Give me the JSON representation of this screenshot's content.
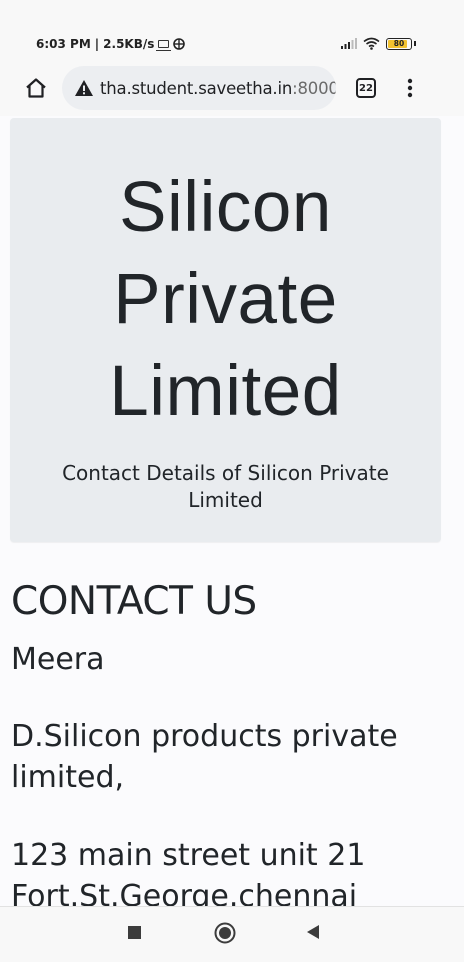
{
  "status_bar": {
    "time": "6:03 PM",
    "network_speed": "2.5KB/s",
    "battery_level": "80",
    "icons": [
      "laptop-icon",
      "globe-icon",
      "signal-icon",
      "wifi-icon",
      "battery-icon"
    ]
  },
  "browser": {
    "url_host": "tha.student.saveetha.in",
    "url_port": ":8000",
    "tab_count": "22",
    "icons": [
      "home-icon",
      "warning-icon",
      "tabs-icon",
      "more-vert-icon"
    ]
  },
  "page": {
    "hero_title": "Silicon Private Limited",
    "hero_subtitle": "Contact Details of Silicon Private Limited",
    "contact_heading": "CONTACT US",
    "contact_name": "Meera",
    "contact_company": "D.Silicon products private limited,",
    "contact_address": "123 main street unit 21 Fort.St.George.chennai"
  },
  "nav_bar": {
    "icons": [
      "recents-square-icon",
      "home-circle-icon",
      "back-triangle-icon"
    ]
  },
  "colors": {
    "hero_background": "#e9ecef",
    "battery_fill": "#f2c230",
    "text": "#212529"
  }
}
